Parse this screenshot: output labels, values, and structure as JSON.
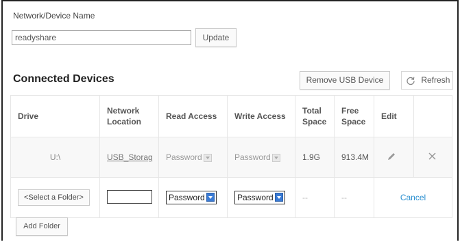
{
  "network": {
    "label": "Network/Device Name",
    "value": "readyshare",
    "update_label": "Update"
  },
  "section": {
    "title": "Connected Devices",
    "remove_usb_label": "Remove USB Device",
    "refresh_label": "Refresh"
  },
  "table": {
    "headers": {
      "drive": "Drive",
      "location_1": "Network",
      "location_2": "Location",
      "read": "Read Access",
      "write": "Write Access",
      "total_1": "Total",
      "total_2": "Space",
      "free_1": "Free",
      "free_2": "Space",
      "edit": "Edit"
    },
    "row": {
      "drive": "U:\\",
      "location": "USB_Storag",
      "read": "Password",
      "write": "Password",
      "total": "1.9G",
      "free": "913.4M"
    },
    "new_row": {
      "folder_label": "<Select a Folder>",
      "read": "Password",
      "write": "Password",
      "total": "--",
      "free": "--",
      "cancel_label": "Cancel"
    }
  },
  "add_folder_label": "Add Folder",
  "colors": {
    "accent": "#2a8fd0",
    "select_arrow": "#3a7bd5"
  },
  "icons": {
    "edit": "pencil-icon",
    "delete": "close-icon",
    "refresh": "refresh-icon"
  }
}
